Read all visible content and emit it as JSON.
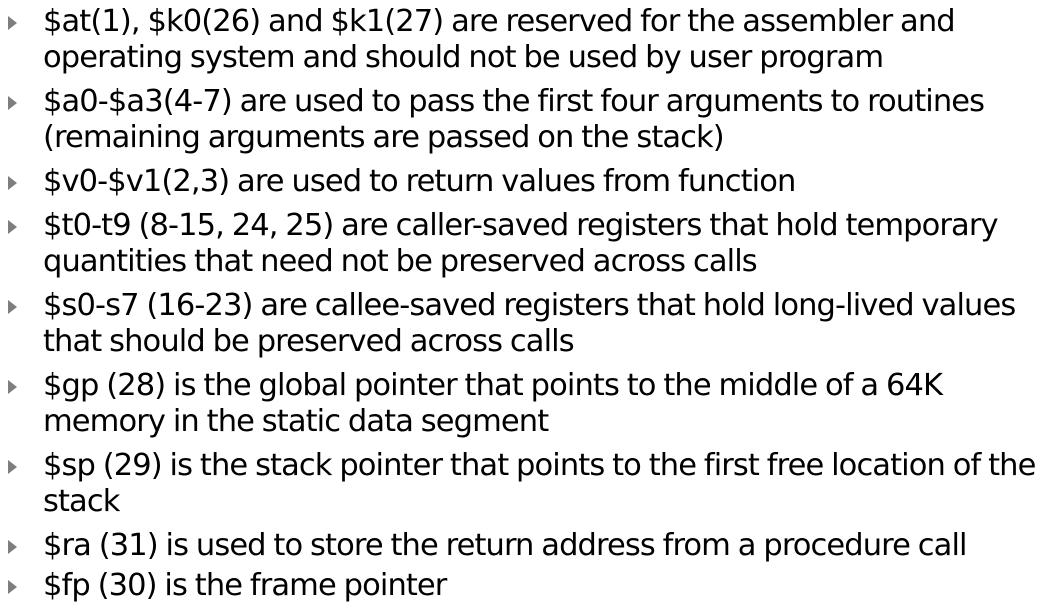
{
  "bullets": [
    "$at(1), $k0(26) and $k1(27) are reserved for the assembler and operating system and should not be used by user program",
    "$a0-$a3(4-7) are used to pass the first four arguments to routines (remaining arguments are passed on the stack)",
    "$v0-$v1(2,3) are used to return values from function",
    "$t0-t9 (8-15, 24, 25) are caller-saved registers that hold temporary quantities that need not be preserved across calls",
    "$s0-s7 (16-23) are callee-saved registers that hold long-lived values that should be preserved across calls",
    "$gp (28) is the global pointer that points to the middle of a 64K memory in the static data segment",
    "$sp (29) is the stack pointer that points to the first free location of the stack",
    "$ra (31) is used to store the return address from a procedure call",
    "$fp (30) is the frame pointer"
  ],
  "marker_icon": "triangle-right-icon",
  "marker_color": "#7e7e7e",
  "text_color": "#000000",
  "background": "#ffffff"
}
